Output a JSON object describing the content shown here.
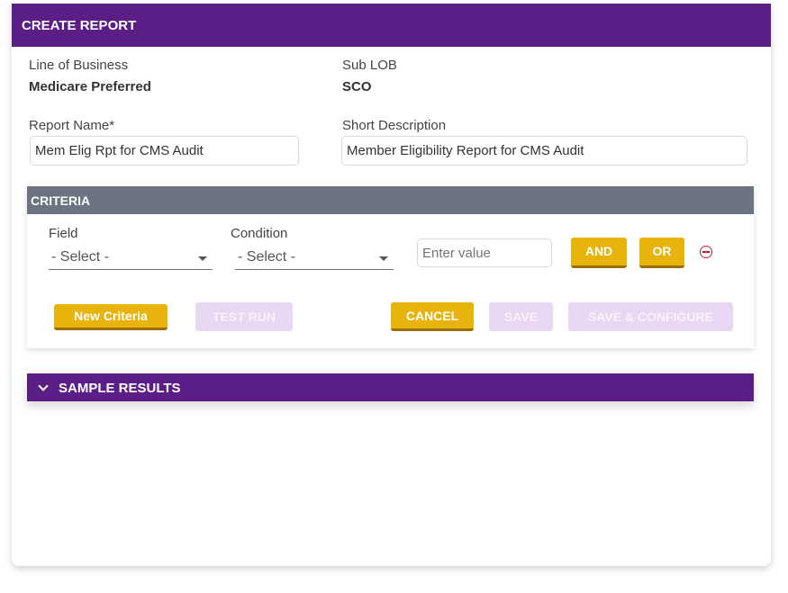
{
  "header": {
    "title": "CREATE REPORT"
  },
  "info": {
    "lob_label": "Line of Business",
    "lob_value": "Medicare Preferred",
    "sublob_label": "Sub LOB",
    "sublob_value": "SCO"
  },
  "form": {
    "report_name_label": "Report Name*",
    "report_name_value": "Mem Elig Rpt for CMS Audit",
    "short_desc_label": "Short Description",
    "short_desc_value": "Member Eligibility Report for CMS Audit"
  },
  "criteria": {
    "title": "CRITERIA",
    "field_label": "Field",
    "field_value": "- Select -",
    "condition_label": "Condition",
    "condition_value": "- Select -",
    "value_placeholder": "Enter value",
    "and_label": "AND",
    "or_label": "OR",
    "new_criteria_label": "New Criteria",
    "test_run_label": "TEST RUN",
    "cancel_label": "CANCEL",
    "save_label": "SAVE",
    "save_configure_label": "SAVE & CONFIGURE"
  },
  "sample": {
    "title": "SAMPLE RESULTS"
  },
  "colors": {
    "header": "#5b1e87",
    "criteria_header": "#6b7480",
    "primary_button": "#e8b30b",
    "disabled_button": "#e9d7f3",
    "remove_icon": "#c62828"
  }
}
